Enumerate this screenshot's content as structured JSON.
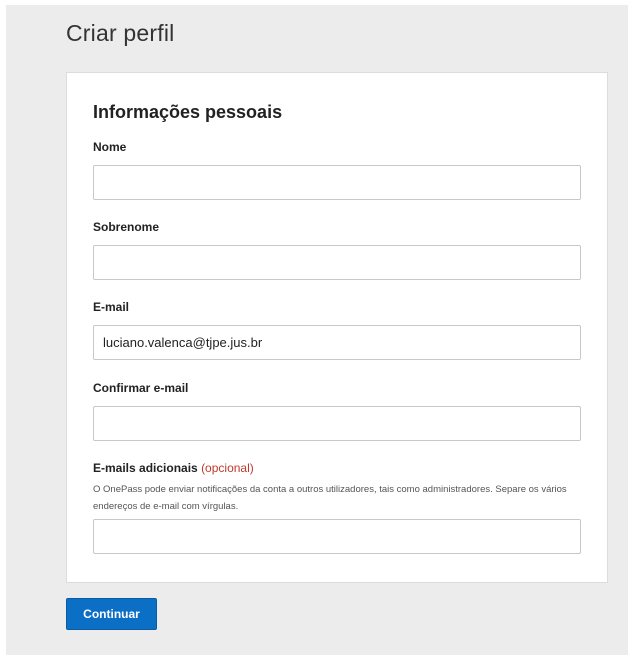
{
  "page": {
    "title": "Criar perfil"
  },
  "form": {
    "section_title": "Informações pessoais",
    "fields": {
      "nome": {
        "label": "Nome",
        "value": ""
      },
      "sobrenome": {
        "label": "Sobrenome",
        "value": ""
      },
      "email": {
        "label": "E-mail",
        "value": "luciano.valenca@tjpe.jus.br"
      },
      "confirm_email": {
        "label": "Confirmar e-mail",
        "value": ""
      },
      "additional_emails": {
        "label": "E-mails adicionais",
        "optional_label": "(opcional)",
        "help": "O OnePass pode enviar notificações da conta a outros utilizadores, tais como administradores. Separe os vários endereços de e-mail com vírgulas.",
        "value": ""
      }
    }
  },
  "actions": {
    "continue_label": "Continuar"
  },
  "colors": {
    "primary": "#0b6fc6",
    "optional_text": "#c0392b",
    "background": "#ececec"
  }
}
